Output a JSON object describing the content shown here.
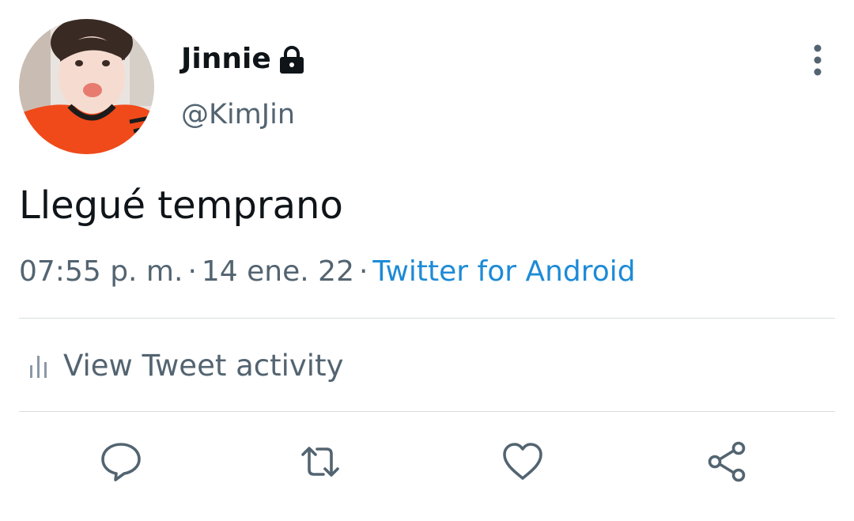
{
  "user": {
    "display_name": "Jinnie",
    "handle": "@KimJin",
    "protected_icon": "lock-icon",
    "avatar_icon": "avatar"
  },
  "tweet": {
    "text": "Llegué temprano",
    "time": "07:55 p. m.",
    "separator": "·",
    "date": "14 ene. 22",
    "source": "Twitter for Android"
  },
  "activity": {
    "label": "View Tweet activity",
    "icon": "bar-chart-icon"
  },
  "actions": {
    "reply_icon": "reply-icon",
    "retweet_icon": "retweet-icon",
    "like_icon": "heart-icon",
    "share_icon": "share-icon"
  },
  "menu_icon": "more-vertical-icon",
  "colors": {
    "text_primary": "#0f1419",
    "text_secondary": "#536471",
    "link": "#1d8bd6",
    "divider": "#d8dde1"
  }
}
